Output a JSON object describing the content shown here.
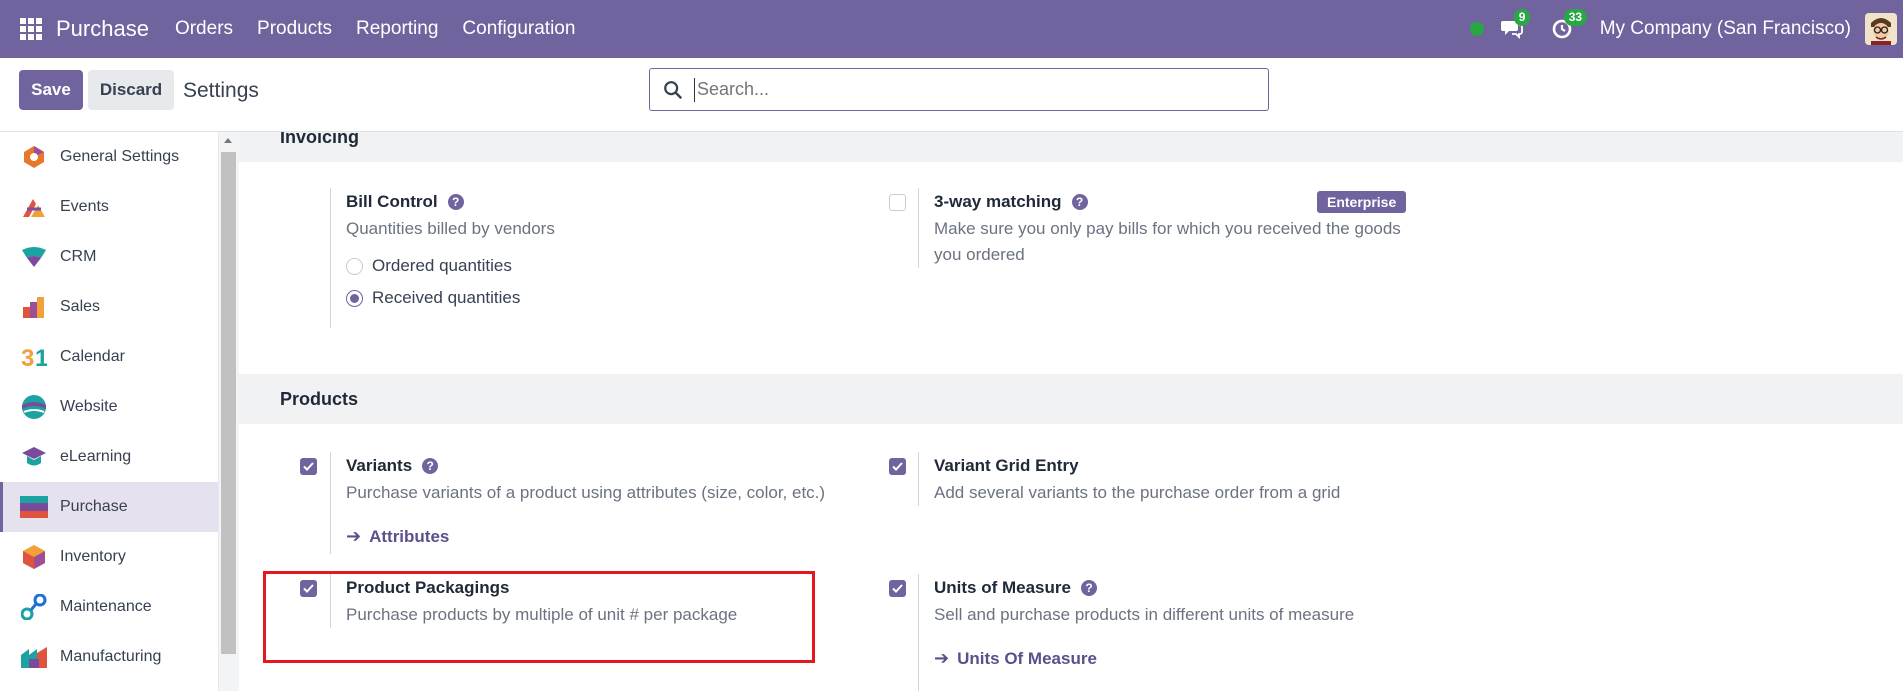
{
  "navbar": {
    "app_name": "Purchase",
    "menu": [
      "Orders",
      "Products",
      "Reporting",
      "Configuration"
    ],
    "messages_count": "9",
    "activities_count": "33",
    "company": "My Company (San Francisco)"
  },
  "control": {
    "save_label": "Save",
    "discard_label": "Discard",
    "title": "Settings",
    "search_placeholder": "Search..."
  },
  "sidebar": {
    "items": [
      {
        "label": "General Settings",
        "icon": "general-settings-icon"
      },
      {
        "label": "Events",
        "icon": "events-icon"
      },
      {
        "label": "CRM",
        "icon": "crm-icon"
      },
      {
        "label": "Sales",
        "icon": "sales-icon"
      },
      {
        "label": "Calendar",
        "icon": "calendar-icon"
      },
      {
        "label": "Website",
        "icon": "website-icon"
      },
      {
        "label": "eLearning",
        "icon": "elearning-icon"
      },
      {
        "label": "Purchase",
        "icon": "purchase-icon",
        "active": true
      },
      {
        "label": "Inventory",
        "icon": "inventory-icon"
      },
      {
        "label": "Maintenance",
        "icon": "maintenance-icon"
      },
      {
        "label": "Manufacturing",
        "icon": "manufacturing-icon"
      }
    ]
  },
  "invoicing": {
    "heading": "Invoicing",
    "bill_control": {
      "title": "Bill Control",
      "desc": "Quantities billed by vendors",
      "options": [
        "Ordered quantities",
        "Received quantities"
      ],
      "selected": "Received quantities"
    },
    "three_way": {
      "title": "3-way matching",
      "badge": "Enterprise",
      "desc_line1": "Make sure you only pay bills for which you received the goods",
      "desc_line2": "you ordered",
      "checked": false
    }
  },
  "products": {
    "heading": "Products",
    "variants": {
      "title": "Variants",
      "desc": "Purchase variants of a product using attributes (size, color, etc.)",
      "link": "Attributes",
      "checked": true
    },
    "variant_grid": {
      "title": "Variant Grid Entry",
      "desc": "Add several variants to the purchase order from a grid",
      "checked": true
    },
    "packagings": {
      "title": "Product Packagings",
      "desc": "Purchase products by multiple of unit # per package",
      "checked": true
    },
    "uom": {
      "title": "Units of Measure",
      "desc": "Sell and purchase products in different units of measure",
      "link": "Units Of Measure",
      "checked": true
    }
  },
  "colors": {
    "brand": "#71639e",
    "highlight": "#e3171d",
    "badge_green": "#28a745"
  }
}
